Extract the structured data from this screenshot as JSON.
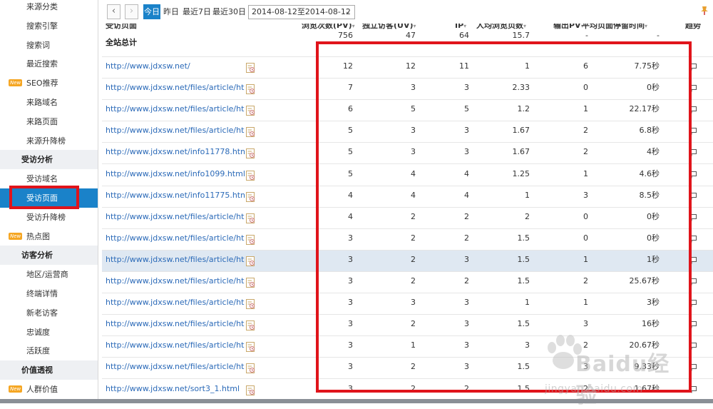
{
  "sidebar": {
    "items": [
      {
        "label": "来源分类",
        "type": "item"
      },
      {
        "label": "搜索引擎",
        "type": "item"
      },
      {
        "label": "搜索词",
        "type": "item"
      },
      {
        "label": "最近搜索",
        "type": "item"
      },
      {
        "label": "SEO推荐",
        "type": "item",
        "badge": "New"
      },
      {
        "label": "来路域名",
        "type": "item"
      },
      {
        "label": "来路页面",
        "type": "item"
      },
      {
        "label": "来源升降榜",
        "type": "item"
      },
      {
        "label": "受访分析",
        "type": "section"
      },
      {
        "label": "受访域名",
        "type": "item"
      },
      {
        "label": "受访页面",
        "type": "item",
        "active": true
      },
      {
        "label": "受访升降榜",
        "type": "item"
      },
      {
        "label": "热点图",
        "type": "item",
        "badge": "New"
      },
      {
        "label": "访客分析",
        "type": "section"
      },
      {
        "label": "地区/运营商",
        "type": "item"
      },
      {
        "label": "终端详情",
        "type": "item"
      },
      {
        "label": "新老访客",
        "type": "item"
      },
      {
        "label": "忠诚度",
        "type": "item"
      },
      {
        "label": "活跃度",
        "type": "item"
      },
      {
        "label": "价值透视",
        "type": "section"
      },
      {
        "label": "人群价值",
        "type": "item",
        "badge": "New"
      }
    ]
  },
  "toolbar": {
    "prev": "‹",
    "next": "›",
    "today": "今日",
    "yesterday": "昨日",
    "last7": "最近7日",
    "last30": "最近30日",
    "date_range": "2014-08-12至2014-08-12"
  },
  "table": {
    "headers": {
      "page": "受访页面",
      "pv": "浏览次数(PV)",
      "uv": "独立访客(UV)",
      "ip": "IP",
      "avg": "人均浏览页数",
      "out": "输出PV",
      "time": "平均页面停留时间",
      "trend": "趋势"
    },
    "total": {
      "label": "全站总计",
      "pv": "756",
      "uv": "47",
      "ip": "64",
      "avg": "15.7",
      "out": "-",
      "time": "-"
    },
    "rows": [
      {
        "url": "http://www.jdxsw.net/",
        "pv": "12",
        "uv": "12",
        "ip": "11",
        "avg": "1",
        "out": "6",
        "time": "7.75秒"
      },
      {
        "url": "http://www.jdxsw.net/files/article/html/6/...",
        "pv": "7",
        "uv": "3",
        "ip": "3",
        "avg": "2.33",
        "out": "0",
        "time": "0秒"
      },
      {
        "url": "http://www.jdxsw.net/files/article/html/1/...",
        "pv": "6",
        "uv": "5",
        "ip": "5",
        "avg": "1.2",
        "out": "1",
        "time": "22.17秒"
      },
      {
        "url": "http://www.jdxsw.net/files/article/html/6/...",
        "pv": "5",
        "uv": "3",
        "ip": "3",
        "avg": "1.67",
        "out": "2",
        "time": "6.8秒"
      },
      {
        "url": "http://www.jdxsw.net/info11778.html",
        "pv": "5",
        "uv": "3",
        "ip": "3",
        "avg": "1.67",
        "out": "2",
        "time": "4秒"
      },
      {
        "url": "http://www.jdxsw.net/info1099.html",
        "pv": "5",
        "uv": "4",
        "ip": "4",
        "avg": "1.25",
        "out": "1",
        "time": "4.6秒"
      },
      {
        "url": "http://www.jdxsw.net/info11775.html",
        "pv": "4",
        "uv": "4",
        "ip": "4",
        "avg": "1",
        "out": "3",
        "time": "8.5秒"
      },
      {
        "url": "http://www.jdxsw.net/files/article/html/6/...",
        "pv": "4",
        "uv": "2",
        "ip": "2",
        "avg": "2",
        "out": "0",
        "time": "0秒"
      },
      {
        "url": "http://www.jdxsw.net/files/article/html/6/...",
        "pv": "3",
        "uv": "2",
        "ip": "2",
        "avg": "1.5",
        "out": "0",
        "time": "0秒"
      },
      {
        "url": "http://www.jdxsw.net/files/article/html/6/...",
        "pv": "3",
        "uv": "2",
        "ip": "3",
        "avg": "1.5",
        "out": "1",
        "time": "1秒",
        "highlight": true
      },
      {
        "url": "http://www.jdxsw.net/files/article/html/6/...",
        "pv": "3",
        "uv": "2",
        "ip": "2",
        "avg": "1.5",
        "out": "2",
        "time": "25.67秒"
      },
      {
        "url": "http://www.jdxsw.net/files/article/html/11...",
        "pv": "3",
        "uv": "3",
        "ip": "3",
        "avg": "1",
        "out": "1",
        "time": "3秒"
      },
      {
        "url": "http://www.jdxsw.net/files/article/html/6/...",
        "pv": "3",
        "uv": "2",
        "ip": "3",
        "avg": "1.5",
        "out": "3",
        "time": "16秒"
      },
      {
        "url": "http://www.jdxsw.net/files/article/html/6/...",
        "pv": "3",
        "uv": "1",
        "ip": "3",
        "avg": "3",
        "out": "2",
        "time": "20.67秒"
      },
      {
        "url": "http://www.jdxsw.net/files/article/html/6/...",
        "pv": "3",
        "uv": "2",
        "ip": "3",
        "avg": "1.5",
        "out": "3",
        "time": "9.33秒"
      },
      {
        "url": "http://www.jdxsw.net/sort3_1.html",
        "pv": "3",
        "uv": "2",
        "ip": "2",
        "avg": "1.5",
        "out": "2",
        "time": "1.67秒"
      }
    ]
  },
  "watermark": {
    "brand": "Baidu经验",
    "sub": "jingyan.baidu.com"
  },
  "colors": {
    "accent": "#1a82c9",
    "link": "#2b6ab8",
    "annotation": "#e0141b",
    "highlight_row": "#dfe8f2"
  }
}
